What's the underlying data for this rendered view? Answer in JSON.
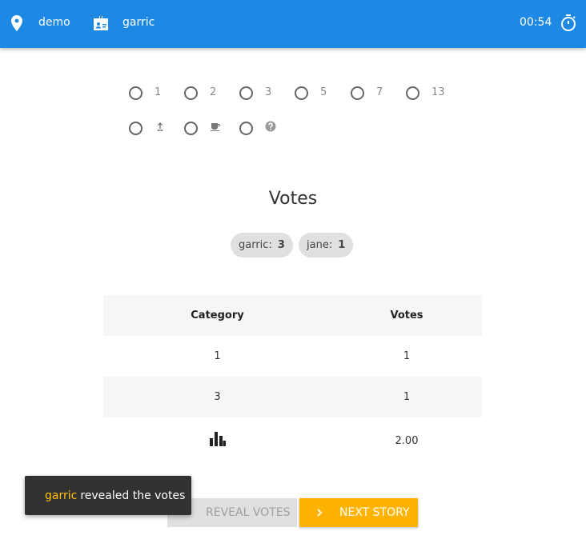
{
  "header": {
    "room": "demo",
    "user": "garric",
    "timer": "00:54",
    "accent_color": "#1e88e5"
  },
  "cards": {
    "row1": [
      {
        "label": "1"
      },
      {
        "label": "2"
      },
      {
        "label": "3"
      },
      {
        "label": "5"
      },
      {
        "label": "7"
      },
      {
        "label": "13"
      }
    ],
    "row2": [
      {
        "icon": "upload-icon"
      },
      {
        "icon": "coffee-icon"
      },
      {
        "icon": "question-icon"
      }
    ]
  },
  "votes": {
    "heading": "Votes",
    "chips": [
      {
        "name": "garric:",
        "value": "3"
      },
      {
        "name": "jane:",
        "value": "1"
      }
    ]
  },
  "table": {
    "headers": [
      "Category",
      "Votes"
    ],
    "rows": [
      {
        "category": "1",
        "votes": "1"
      },
      {
        "category": "3",
        "votes": "1"
      }
    ],
    "summary": {
      "icon": "bar-chart-icon",
      "value": "2.00"
    }
  },
  "actions": {
    "reveal": "Reveal Votes",
    "next": "Next Story",
    "next_color": "#ffb300"
  },
  "snackbar": {
    "user": "garric",
    "message": "revealed the votes"
  }
}
